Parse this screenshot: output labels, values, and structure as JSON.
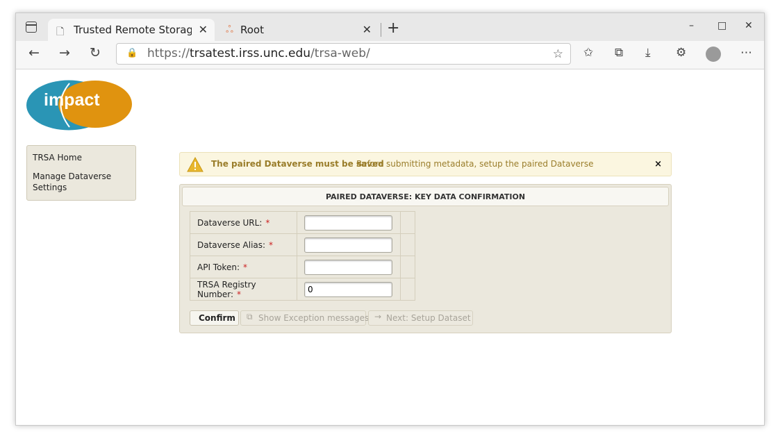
{
  "browser": {
    "tabs": [
      {
        "title": "Trusted Remote Storage Agent",
        "icon": "page-icon",
        "active": true
      },
      {
        "title": "Root",
        "icon": "cloudflare-tunnel-icon",
        "active": false
      }
    ],
    "window_controls": {
      "minimize": "–",
      "maximize": "□",
      "close": "✕"
    },
    "address": {
      "scheme": "https://",
      "host": "trsatest.irss.unc.edu",
      "path": "/trsa-web/"
    },
    "toolbar_icons": [
      "back-icon",
      "forward-icon",
      "refresh-icon",
      "favorites-star-icon",
      "favorites-list-icon",
      "collections-icon",
      "downloads-icon",
      "extensions-icon",
      "profile-avatar-icon",
      "more-menu-icon"
    ]
  },
  "logo": {
    "text": "impact",
    "colors": {
      "left": "#2a95b5",
      "right": "#e0930f"
    }
  },
  "sidebar": {
    "items": [
      {
        "label": "TRSA Home"
      },
      {
        "label": "Manage Dataverse Settings"
      }
    ]
  },
  "alert": {
    "summary": "The paired Dataverse must be saved",
    "detail": "Before submitting metadata, setup the paired Dataverse",
    "close": "×"
  },
  "panel": {
    "title": "PAIRED DATAVERSE: KEY DATA CONFIRMATION",
    "required_marker": "*",
    "fields": [
      {
        "label": "Dataverse URL:",
        "value": ""
      },
      {
        "label": "Dataverse Alias:",
        "value": ""
      },
      {
        "label": "API Token:",
        "value": ""
      },
      {
        "label": "TRSA Registry Number:",
        "value": "0"
      }
    ],
    "buttons": {
      "confirm": "Confirm",
      "show_exceptions": "Show Exception messages",
      "next": "Next: Setup Dataset"
    }
  },
  "colors": {
    "accent_text": "#9a7d2a",
    "required": "#cc2222",
    "panel_bg": "#ebe8dd"
  }
}
